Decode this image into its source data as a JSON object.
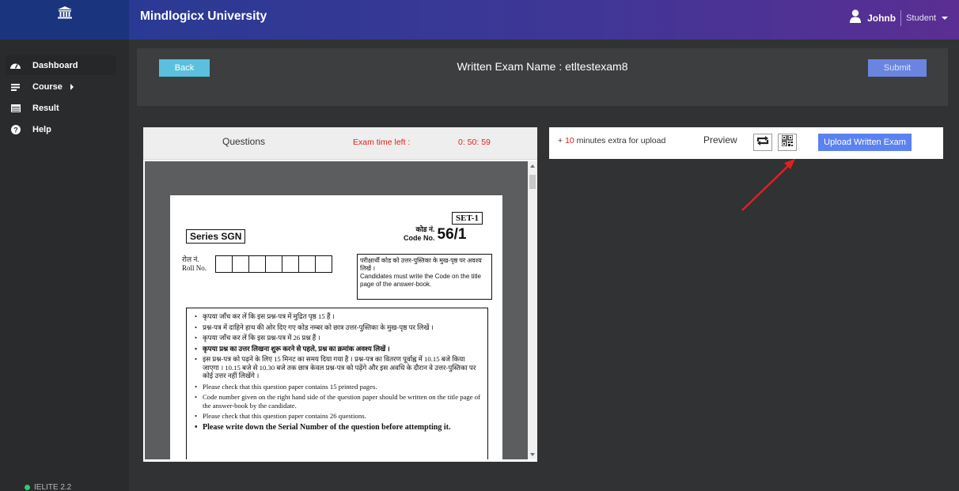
{
  "header": {
    "logo_icon": "university-building-icon",
    "brand_title": "Mindlogicx University",
    "user": {
      "icon": "user-icon",
      "name": "Johnb",
      "role": "Student",
      "caret": "chevron-down-icon"
    },
    "colors": {
      "logo_bg": "#1a347d",
      "gradient_start": "#2a3a94",
      "gradient_end": "#5b2e93"
    }
  },
  "sidebar": {
    "items": [
      {
        "label": "Dashboard",
        "icon": "dashboard-gauge-icon",
        "active": true
      },
      {
        "label": "Course",
        "icon": "list-icon",
        "has_submenu": true
      },
      {
        "label": "Result",
        "icon": "result-table-icon"
      },
      {
        "label": "Help",
        "icon": "help-question-icon"
      }
    ],
    "version": "IELITE 2.2"
  },
  "exam_header": {
    "back_label": "Back",
    "title": "Written Exam Name : etltestexam8",
    "submit_label": "Submit"
  },
  "questions": {
    "title": "Questions",
    "timer_label": "Exam time left :",
    "timer_value": "0: 50: 59",
    "paper": {
      "set": "SET-1",
      "series": "Series SGN",
      "code_label_hi": "कोड नं.",
      "code_label_en": "Code No.",
      "code_value": "56/1",
      "roll_label_hi": "रोल नं.",
      "roll_label_en": "Roll No.",
      "note_hi": "परीक्षार्थी कोड को उत्तर-पुस्तिका के मुख-पृष्ठ पर अवश्य लिखें ।",
      "note_en": "Candidates must write the Code on the title page of the answer-book.",
      "instructions": [
        {
          "text": "कृपया जाँच कर लें कि इस प्रश्न-पत्र में मुद्रित पृष्ठ 15 हैं ।",
          "style": "normal"
        },
        {
          "text": "प्रश्न-पत्र में दाहिने हाथ की ओर दिए गए कोड नम्बर को छात्र उत्तर-पुस्तिका के मुख-पृष्ठ पर लिखें ।",
          "style": "normal"
        },
        {
          "text": "कृपया जाँच कर लें कि इस प्रश्न-पत्र में 26 प्रश्न हैं ।",
          "style": "normal"
        },
        {
          "text": "कृपया प्रश्न का उत्तर लिखना शुरू करने से पहले, प्रश्न का क्रमांक अवश्य लिखें ।",
          "style": "bold"
        },
        {
          "text": "इस प्रश्न-पत्र को पढ़ने के लिए 15 मिनट का समय दिया गया है । प्रश्न-पत्र का वितरण पूर्वाह्न में 10.15 बजे किया जाएगा । 10.15 बजे से 10.30 बजे तक छात्र केवल प्रश्न-पत्र को पढ़ेंगे और इस अवधि के दौरान वे उत्तर-पुस्तिका पर कोई उत्तर नहीं लिखेंगे ।",
          "style": "normal"
        },
        {
          "text": "Please check that this question paper contains 15 printed pages.",
          "style": "normal"
        },
        {
          "text": "Code number given on the right hand side of the question paper should be written on the title page of the answer-book by the candidate.",
          "style": "normal"
        },
        {
          "text": "Please check that this question paper contains 26 questions.",
          "style": "normal"
        },
        {
          "text": "Please write down the Serial Number of the question before attempting it.",
          "style": "big"
        }
      ]
    }
  },
  "upload": {
    "extra_prefix": "+ ",
    "extra_minutes": "10",
    "extra_suffix": " minutes extra for upload",
    "preview_label": "Preview",
    "rotate_icon": "rotate-refresh-icon",
    "qr_icon": "qr-code-icon",
    "upload_label": "Upload Written Exam",
    "annotation_arrow_color": "#e02020"
  }
}
